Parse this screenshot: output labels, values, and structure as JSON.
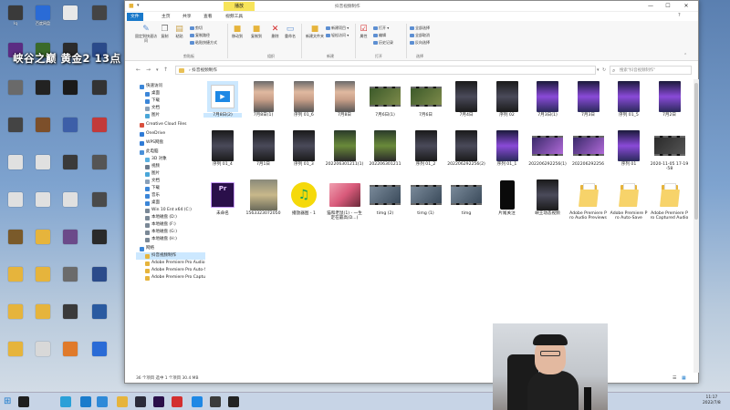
{
  "overlay_text": "峡谷之巅 黄金2 13点",
  "window": {
    "title": "抖音视频制作",
    "context_tab": "播放",
    "tabs": [
      "文件",
      "主页",
      "共享",
      "查看",
      "视频工具"
    ],
    "controls": [
      "—",
      "☐",
      "✕"
    ]
  },
  "ribbon": {
    "pin_quick": "固定到快速访问",
    "copy": "复制",
    "paste": "粘贴",
    "cut": "剪切",
    "copy_path": "复制路径",
    "paste_shortcut": "粘贴快捷方式",
    "move_to": "移动到",
    "copy_to": "复制到",
    "delete": "删除",
    "rename": "重命名",
    "new_folder": "新建文件夹",
    "new_item": "新建项目 ▾",
    "easy_access": "轻松访问 ▾",
    "properties": "属性",
    "open": "打开 ▾",
    "edit": "编辑",
    "history": "历史记录",
    "select_all": "全部选择",
    "select_none": "全部取消",
    "invert": "反向选择",
    "groups": [
      "剪贴板",
      "组织",
      "新建",
      "打开",
      "选择"
    ]
  },
  "address": {
    "path": "› 抖音视频制作",
    "search_placeholder": "搜索\"抖音视频制作\""
  },
  "nav": [
    {
      "label": "快速访问",
      "icon": "star-icon",
      "color": "#3b86d8",
      "indent": 0
    },
    {
      "label": "桌面",
      "icon": "desktop-icon",
      "color": "#3b86d8",
      "indent": 1
    },
    {
      "label": "下载",
      "icon": "download-icon",
      "color": "#3b86d8",
      "indent": 1
    },
    {
      "label": "文档",
      "icon": "document-icon",
      "color": "#8aa0b8",
      "indent": 1
    },
    {
      "label": "图片",
      "icon": "picture-icon",
      "color": "#49a6d8",
      "indent": 1
    },
    {
      "label": "Creative Cloud Files",
      "icon": "creative-cloud-icon",
      "color": "#d94f3d",
      "indent": 0
    },
    {
      "label": "OneDrive",
      "icon": "onedrive-icon",
      "color": "#2f7bd6",
      "indent": 0
    },
    {
      "label": "WPS网盘",
      "icon": "cloud-icon",
      "color": "#2f7bd6",
      "indent": 0
    },
    {
      "label": "此电脑",
      "icon": "computer-icon",
      "color": "#4a90d9",
      "indent": 0
    },
    {
      "label": "3D 对象",
      "icon": "cube-icon",
      "color": "#5ab0e0",
      "indent": 1
    },
    {
      "label": "视频",
      "icon": "video-icon",
      "color": "#6b7a8c",
      "indent": 1
    },
    {
      "label": "图片",
      "icon": "picture-icon",
      "color": "#49a6d8",
      "indent": 1
    },
    {
      "label": "文档",
      "icon": "document-icon",
      "color": "#8aa0b8",
      "indent": 1
    },
    {
      "label": "下载",
      "icon": "download-icon",
      "color": "#3b86d8",
      "indent": 1
    },
    {
      "label": "音乐",
      "icon": "music-icon",
      "color": "#3b86d8",
      "indent": 1
    },
    {
      "label": "桌面",
      "icon": "desktop-icon",
      "color": "#3b86d8",
      "indent": 1
    },
    {
      "label": "Win 10 Ent x64 (C:)",
      "icon": "drive-icon",
      "color": "#7a8896",
      "indent": 1
    },
    {
      "label": "本地磁盘 (D:)",
      "icon": "drive-icon",
      "color": "#7a8896",
      "indent": 1
    },
    {
      "label": "本地磁盘 (F:)",
      "icon": "drive-icon",
      "color": "#7a8896",
      "indent": 1
    },
    {
      "label": "本地磁盘 (G:)",
      "icon": "drive-icon",
      "color": "#7a8896",
      "indent": 1
    },
    {
      "label": "本地磁盘 (H:)",
      "icon": "drive-icon",
      "color": "#7a8896",
      "indent": 1
    },
    {
      "label": "网络",
      "icon": "network-icon",
      "color": "#3b86d8",
      "indent": 0
    },
    {
      "label": "抖音视频制作",
      "icon": "folder-icon",
      "color": "#e6b43c",
      "indent": 1,
      "selected": true
    },
    {
      "label": "Adobe Premiere Pro Audio Previews",
      "icon": "folder-icon",
      "color": "#e6b43c",
      "indent": 1
    },
    {
      "label": "Adobe Premiere Pro Auto-Save",
      "icon": "folder-icon",
      "color": "#e6b43c",
      "indent": 1
    },
    {
      "label": "Adobe Premiere Pro Captured Audio",
      "icon": "folder-icon",
      "color": "#e6b43c",
      "indent": 1
    }
  ],
  "files": [
    {
      "name": "7月8日(2)",
      "kind": "app-video",
      "selected": true
    },
    {
      "name": "7月8日(1)",
      "kind": "face"
    },
    {
      "name": "序列 01_6",
      "kind": "face"
    },
    {
      "name": "7月8日",
      "kind": "face"
    },
    {
      "name": "7月6日(1)",
      "kind": "film-green"
    },
    {
      "name": "7月6日",
      "kind": "film-green"
    },
    {
      "name": "7月4日",
      "kind": "game-dark"
    },
    {
      "name": "序列 02",
      "kind": "game-dark"
    },
    {
      "name": "7月3日(1)",
      "kind": "game-purple"
    },
    {
      "name": "7月3日",
      "kind": "game-purple"
    },
    {
      "name": "序列 01_5",
      "kind": "game-purple"
    },
    {
      "name": "7月2日",
      "kind": "game-purple"
    },
    {
      "name": "序列 01_4",
      "kind": "game-dark"
    },
    {
      "name": "7月1日",
      "kind": "game-dark"
    },
    {
      "name": "序列 01_3",
      "kind": "game-dark"
    },
    {
      "name": "202206301211(1)",
      "kind": "game-green"
    },
    {
      "name": "202206301211",
      "kind": "game-green"
    },
    {
      "name": "序列 01_2",
      "kind": "game-dark"
    },
    {
      "name": "202206292256(2)",
      "kind": "game-dark"
    },
    {
      "name": "序列 01_1",
      "kind": "game-purple"
    },
    {
      "name": "202206292256(1)",
      "kind": "film-purple"
    },
    {
      "name": "202206292256",
      "kind": "film-purple"
    },
    {
      "name": "序列 01",
      "kind": "game-purple"
    },
    {
      "name": "2020-11-05 17-19-58",
      "kind": "film-dark"
    },
    {
      "name": "未命名",
      "kind": "pr"
    },
    {
      "name": "1563323072050",
      "kind": "photo"
    },
    {
      "name": "播放器图 - 1",
      "kind": "music-app"
    },
    {
      "name": "猫和老鼠(1) - 一生定在最高(D...)",
      "kind": "pink"
    },
    {
      "name": "timg (2)",
      "kind": "film-grey"
    },
    {
      "name": "timg (1)",
      "kind": "film-grey"
    },
    {
      "name": "timg",
      "kind": "film-grey"
    },
    {
      "name": "片尾关注",
      "kind": "phone"
    },
    {
      "name": "峡王动态视频",
      "kind": "game-dark"
    },
    {
      "name": "Adobe Premiere Pro Audio Previews",
      "kind": "folder"
    },
    {
      "name": "Adobe Premiere Pro Auto-Save",
      "kind": "folder"
    },
    {
      "name": "Adobe Premiere Pro Captured Audio",
      "kind": "folder"
    }
  ],
  "status": "36 个项目    选中 1 个项目  30.4 MB",
  "clock": {
    "time": "11:17",
    "date": "2022/7/8"
  },
  "desktop_icons": [
    {
      "label": "Iq",
      "color": "#3a3a3a"
    },
    {
      "label": "百度网盘",
      "color": "#2a6bd6"
    },
    {
      "label": "",
      "color": "#e8e8e8"
    },
    {
      "label": "",
      "color": "#444"
    },
    {
      "label": "",
      "color": "#5b2c83"
    },
    {
      "label": "",
      "color": "#3a6a2a"
    },
    {
      "label": "",
      "color": "#2b2b2b"
    },
    {
      "label": "",
      "color": "#2a4a8a"
    },
    {
      "label": "",
      "color": "#6a6a6a"
    },
    {
      "label": "",
      "color": "#222"
    },
    {
      "label": "",
      "color": "#1a1a1a"
    },
    {
      "label": "",
      "color": "#333"
    },
    {
      "label": "",
      "color": "#444"
    },
    {
      "label": "",
      "color": "#7c4f2a"
    },
    {
      "label": "",
      "color": "#3d5fa8"
    },
    {
      "label": "",
      "color": "#c23a3a"
    },
    {
      "label": "",
      "color": "#e0e0e0"
    },
    {
      "label": "",
      "color": "#e0e0e0"
    },
    {
      "label": "",
      "color": "#3a3a3a"
    },
    {
      "label": "",
      "color": "#555"
    },
    {
      "label": "",
      "color": "#e0e0e0"
    },
    {
      "label": "",
      "color": "#e0e0e0"
    },
    {
      "label": "",
      "color": "#e0e0e0"
    },
    {
      "label": "",
      "color": "#4a4a4a"
    },
    {
      "label": "",
      "color": "#7a5a2a"
    },
    {
      "label": "",
      "color": "#e6b43c"
    },
    {
      "label": "",
      "color": "#6b4a8a"
    },
    {
      "label": "",
      "color": "#2a2a2a"
    },
    {
      "label": "",
      "color": "#e6b43c"
    },
    {
      "label": "",
      "color": "#e6b43c"
    },
    {
      "label": "",
      "color": "#6b6b6b"
    },
    {
      "label": "",
      "color": "#2b4b8b"
    },
    {
      "label": "",
      "color": "#e6b43c"
    },
    {
      "label": "",
      "color": "#e6b43c"
    },
    {
      "label": "",
      "color": "#3a3a3a"
    },
    {
      "label": "",
      "color": "#2a5aa0"
    },
    {
      "label": "",
      "color": "#e6b43c"
    },
    {
      "label": "",
      "color": "#d8d8d8"
    },
    {
      "label": "",
      "color": "#e07a2a"
    },
    {
      "label": "",
      "color": "#2a6bd6"
    }
  ]
}
